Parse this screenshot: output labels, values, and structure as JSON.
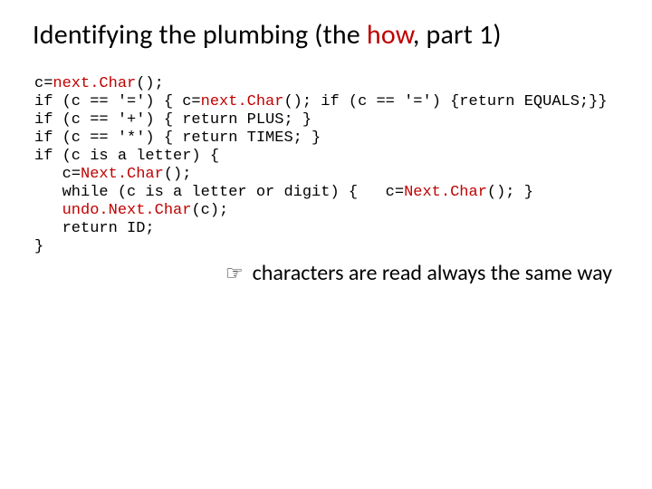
{
  "title": {
    "pre": "Identifying the plumbing (the ",
    "how": "how",
    "post": ", part 1)"
  },
  "code": {
    "l1a": "c=",
    "l1b": "next.Char",
    "l1c": "();",
    "l2a": "if (c == '=') { c=",
    "l2b": "next.Char",
    "l2c": "(); if (c == '=') {return EQUALS;}}",
    "l3": "if (c == '+') { return PLUS; }",
    "l4": "if (c == '*') { return TIMES; }",
    "l5": "if (c is a letter) {",
    "l6a": "   c=",
    "l6b": "Next.Char",
    "l6c": "();",
    "l7a": "   while (c is a letter or digit) {   c=",
    "l7b": "Next.Char",
    "l7c": "(); }",
    "l8a": "   ",
    "l8b": "undo.Next.Char",
    "l8c": "(c);",
    "l9": "   return ID;",
    "l10": "}"
  },
  "footer": {
    "icon": "☞",
    "text": "characters are read always the same way"
  }
}
